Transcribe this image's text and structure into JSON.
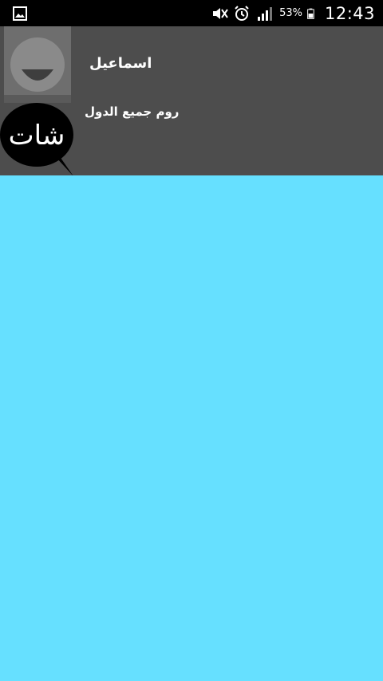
{
  "status_bar": {
    "battery_percent": "53%",
    "time": "12:43",
    "icons": [
      "gallery-icon",
      "mute-icon",
      "alarm-icon",
      "signal-icon",
      "battery-icon"
    ]
  },
  "drawer_header": {
    "user_name": "اسماعيل",
    "room_name": "روم جميع الدول",
    "logo_text": "شات"
  },
  "colors": {
    "status_bar": "#000000",
    "header_bg": "#4d4d4d",
    "content_bg": "#66e0ff"
  }
}
